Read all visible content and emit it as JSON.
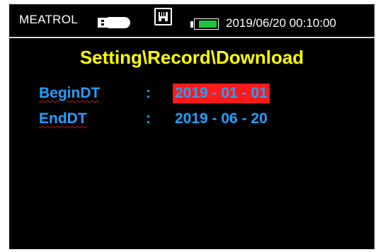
{
  "status_bar": {
    "brand": "MEATROL",
    "datetime": "2019/06/20 00:10:00",
    "icons": [
      "usb-drive-icon",
      "network-port-icon",
      "battery-icon"
    ],
    "battery_level": 0.85,
    "battery_color": "#1fc43a"
  },
  "screen": {
    "title": "Setting\\Record\\Download",
    "title_color": "#ffff00",
    "text_color": "#22a0ff",
    "highlight_color": "#ff1a1a",
    "fields": [
      {
        "label": "BeginDT",
        "separator": ":",
        "value": "2019 - 01 - 01",
        "selected": true
      },
      {
        "label": "EndDT",
        "separator": ":",
        "value": "2019 - 06 - 20",
        "selected": false
      }
    ]
  }
}
